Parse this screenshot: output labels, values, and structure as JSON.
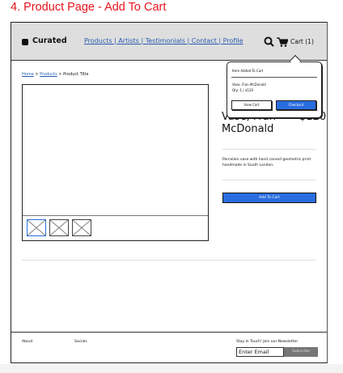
{
  "page_title": "4. Product Page - Add To Cart",
  "header": {
    "logo": "Curated",
    "nav": "Products | Artists | Testimonials | Contact | Profile",
    "cart_label": "Cart (1)"
  },
  "breadcrumb": {
    "home": "Home",
    "products": "Products",
    "current": "Product Title",
    "sep": ">"
  },
  "product": {
    "title": "Vase, Fran McDonald",
    "price": "$120",
    "description": "Porcelain vase with hand carved geometric print handmade in South London.",
    "add_to_cart": "Add To Cart",
    "thumbnails": 3,
    "selected_thumbnail": 1
  },
  "cart_popover": {
    "heading": "Item Added To Cart",
    "item_name": "Vase, Fran McDonald",
    "item_detail": "Qty: 1  |  $120",
    "view_cart": "View Cart",
    "checkout": "Checkout"
  },
  "footer": {
    "about": "About",
    "socials": "Socials",
    "newsletter": "Stay In Touch! Join our Newsletter.",
    "email_placeholder": "Enter Email",
    "subscribe": "Subscribe"
  },
  "colors": {
    "title": "#e8141b",
    "accent": "#2a6de0",
    "link": "#2a5db0",
    "header_bg": "#dedede"
  }
}
